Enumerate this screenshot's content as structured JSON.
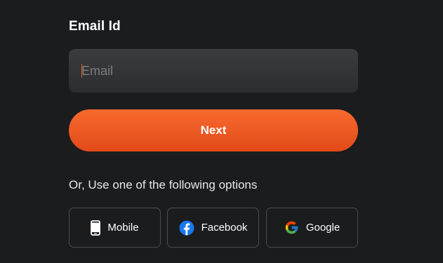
{
  "email": {
    "label": "Email Id",
    "placeholder": "Email",
    "value": ""
  },
  "next_button": {
    "label": "Next"
  },
  "alternatives": {
    "prompt": "Or, Use one of the following options",
    "options": [
      {
        "label": "Mobile",
        "icon": "mobile-phone-icon"
      },
      {
        "label": "Facebook",
        "icon": "facebook-icon"
      },
      {
        "label": "Google",
        "icon": "google-icon"
      }
    ]
  },
  "colors": {
    "background": "#1b1c1d",
    "accent": "#f15a24",
    "facebook_blue": "#1877f2"
  }
}
